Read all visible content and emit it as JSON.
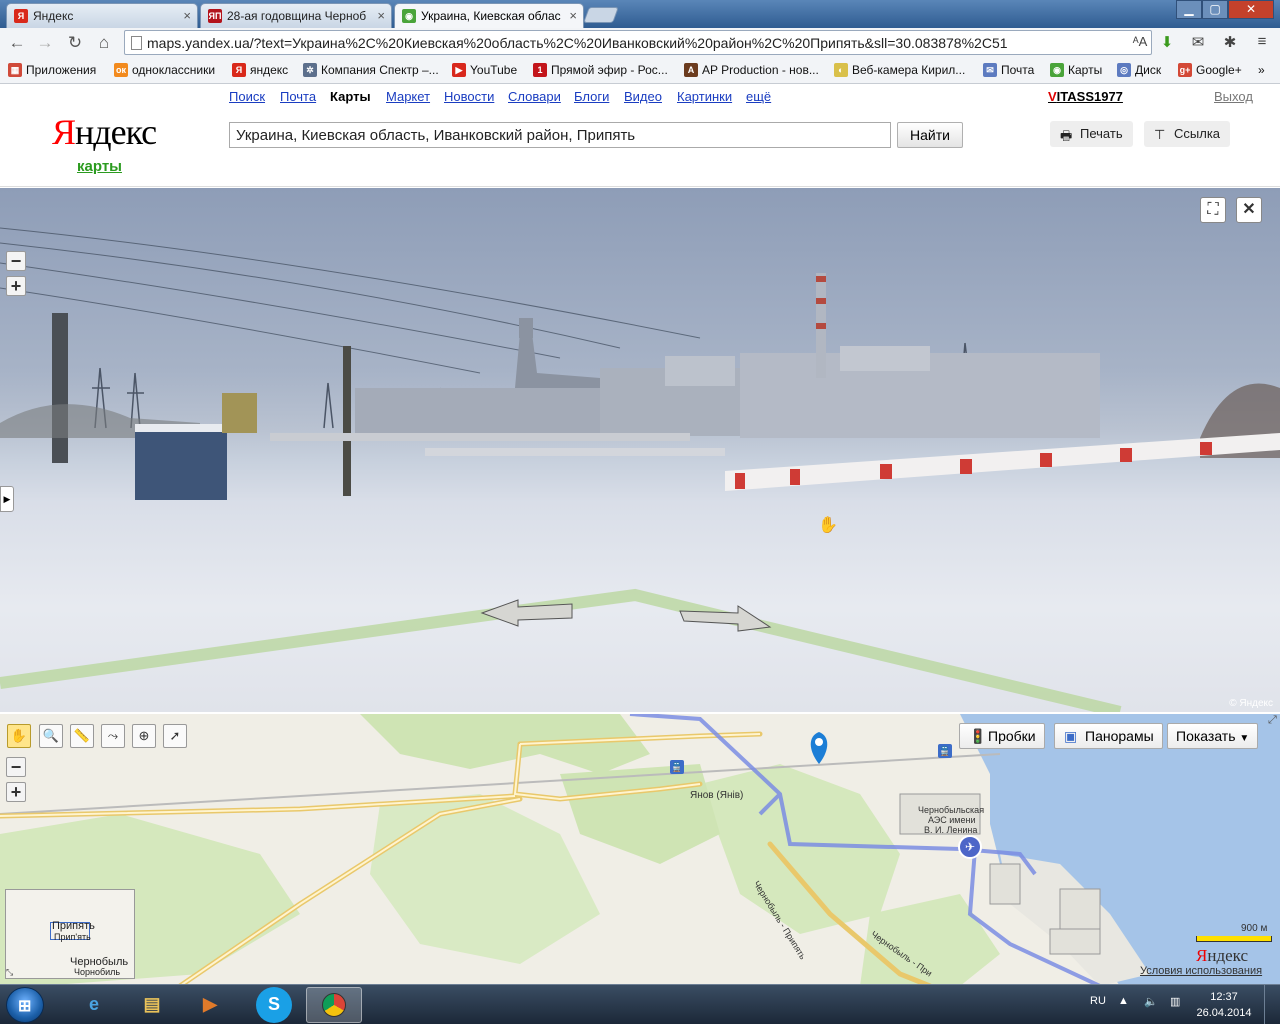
{
  "browser": {
    "tabs": [
      {
        "title": "Яндекс",
        "favicon": "yandex-favicon"
      },
      {
        "title": "28-ая годовщина Черноб",
        "favicon": "yaplakal-favicon"
      },
      {
        "title": "Украина, Киевская облас",
        "favicon": "yandex-maps-favicon"
      }
    ],
    "url": "maps.yandex.ua/?text=Украина%2C%20Киевская%20область%2C%20Иванковский%20район%2C%20Припять&sll=30.083878%2C51",
    "bookmarks": [
      {
        "label": "Приложения",
        "icon": "apps-icon",
        "color": "#d04a3a"
      },
      {
        "label": "одноклассники",
        "icon": "ok-icon",
        "color": "#f28a1e"
      },
      {
        "label": "яндекс",
        "icon": "yandex-icon",
        "color": "#d9291b"
      },
      {
        "label": "Компания Спектр –...",
        "icon": "spektr-icon",
        "color": "#5c6f8c"
      },
      {
        "label": "YouTube",
        "icon": "youtube-icon",
        "color": "#d8281d"
      },
      {
        "label": "Прямой эфир - Рос...",
        "icon": "tv1-icon",
        "color": "#c3151b"
      },
      {
        "label": "AP Production - нов...",
        "icon": "ap-icon",
        "color": "#6b3b1e"
      },
      {
        "label": "Веб-камера Кирил...",
        "icon": "webcam-icon",
        "color": "#d9c04a"
      },
      {
        "label": "Почта",
        "icon": "mail-icon",
        "color": "#5d7bc0"
      },
      {
        "label": "Карты",
        "icon": "maps-icon",
        "color": "#4aa43a"
      },
      {
        "label": "Диск",
        "icon": "disk-icon",
        "color": "#5d7bc0"
      },
      {
        "label": "Google+",
        "icon": "googleplus-icon",
        "color": "#d34836"
      }
    ],
    "bookmarks_more": "»"
  },
  "header": {
    "logo": {
      "first": "Я",
      "rest": "ндекс"
    },
    "service": "карты",
    "nav": [
      "Поиск",
      "Почта",
      "Карты",
      "Маркет",
      "Новости",
      "Словари",
      "Блоги",
      "Видео",
      "Картинки",
      "ещё"
    ],
    "current_nav": "Карты",
    "search_value": "Украина, Киевская область, Иванковский район, Припять",
    "search_button": "Найти",
    "user": {
      "first": "V",
      "rest": "ITASS1977"
    },
    "logout": "Выход",
    "print_label": "Печать",
    "link_label": "Ссылка"
  },
  "panorama": {
    "copyright": "© Яндекс",
    "zoom_out": "−",
    "zoom_in": "+"
  },
  "map": {
    "tools": [
      "hand-tool-icon",
      "magnifier-tool-icon",
      "ruler-tool-icon",
      "route-tool-icon",
      "add-point-tool-icon",
      "select-tool-icon"
    ],
    "traffic_label": "Пробки",
    "panoramas_label": "Панорамы",
    "show_label": "Показать",
    "labels": {
      "yanov": "Янов (Янів)",
      "npp_line1": "Чернобыльская",
      "npp_line2": "АЭС имени",
      "npp_line3": "В. И. Ленина",
      "road1": "Чернобыль - Припять",
      "road2": "Чернобыль - При"
    },
    "scale_label": "900 м",
    "logo": {
      "first": "Я",
      "rest": "ндекс"
    },
    "terms": "Условия использования",
    "minimap": {
      "pripyat": "Припять",
      "pripyat_small": "Прип'ять",
      "chernobyl": "Чернобыль",
      "chernobyl_small": "Чорнобиль"
    }
  },
  "taskbar": {
    "lang": "RU",
    "time": "12:37",
    "date": "26.04.2014"
  },
  "colors": {
    "accent_green": "#2b9b1f",
    "link_blue": "#1a3dc1",
    "yandex_red": "#ff0000"
  }
}
